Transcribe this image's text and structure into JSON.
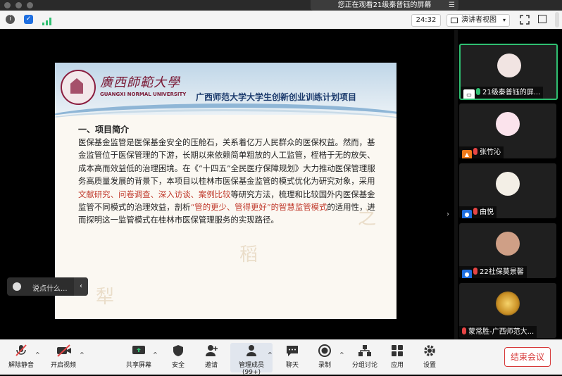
{
  "titlebar": {
    "viewing_text": "您正在观看21级秦普钰的屏幕",
    "menu_icon": "☰"
  },
  "topbar": {
    "timer": "24:32",
    "view_select": "演讲者视图"
  },
  "slide": {
    "uni_cn": "廣西師範大學",
    "uni_en": "GUANGXI NORMAL UNIVERSITY",
    "project_title": "广西师范大学大学生创新创业训练计划项目",
    "section_title": "一、项目简介",
    "p1": "医保基金监管是医保基金安全的压舱石，关系着亿万人民群众的医保权益。然而，基金监管位于医保管理的下游，长期以来依赖简单粗放的人工监管，桎梏于无的放矢、成本高而效益低的治理困境。在《“十四五”全民医疗保障规划》大力推动医保管理服务高质量发展的背景下，本项目以桂林市医保基金监管的模式优化为研究对象，采用",
    "red1": "文献研究、问卷调查、深入访谈、案例比较",
    "p2": "等研究方法，梳理和比较国外内医保基金监管不同模式的治理效益，剖析",
    "red2": "“管的更少、管得更好”的智慧监管模式",
    "p3": "的适用性，进而探明这一监管模式在桂林市医保管理服务的实现路径。"
  },
  "chat": {
    "placeholder": "说点什么..."
  },
  "participants": [
    {
      "name": "21级秦普钰的屏...",
      "active": true
    },
    {
      "name": "张竹沁"
    },
    {
      "name": "由悦"
    },
    {
      "name": "22社保莫景馨"
    },
    {
      "name": "蒙常胜-广西师范大..."
    }
  ],
  "toolbar": {
    "unmute": "解除静音",
    "video": "开启视频",
    "share": "共享屏幕",
    "security": "安全",
    "invite": "邀请",
    "members": "管理成员(99+)",
    "chat": "聊天",
    "record": "录制",
    "breakout": "分组讨论",
    "apps": "应用",
    "settings": "设置",
    "end": "结束会议"
  },
  "colors": {
    "accent_green": "#2fbf71",
    "end_red": "#d73a3a",
    "school_red": "#7a1a36"
  }
}
